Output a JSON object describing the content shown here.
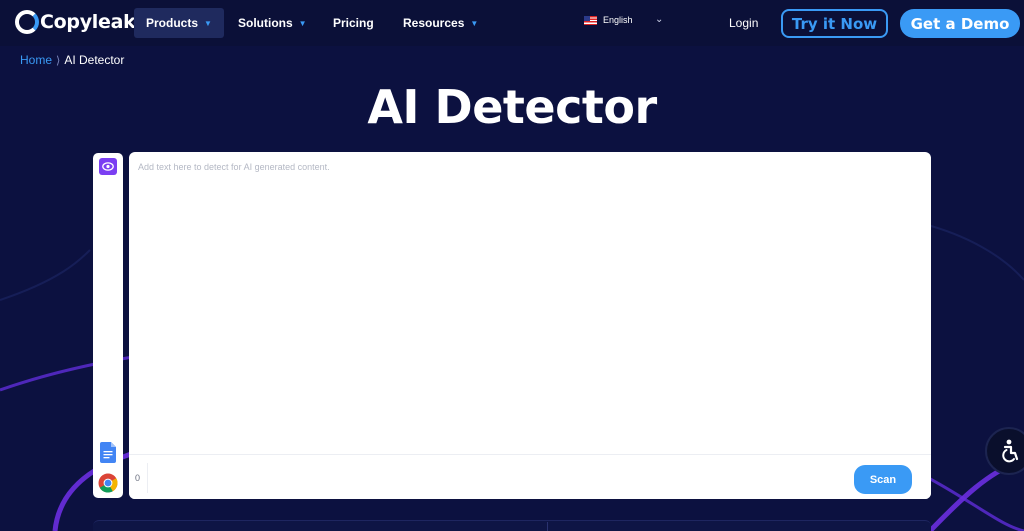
{
  "nav": {
    "logo_text": "Copyleaks",
    "items": [
      {
        "label": "Products",
        "has_caret": true,
        "active": true
      },
      {
        "label": "Solutions",
        "has_caret": true,
        "active": false
      },
      {
        "label": "Pricing",
        "has_caret": false,
        "active": false
      },
      {
        "label": "Resources",
        "has_caret": true,
        "active": false
      }
    ],
    "language": "English",
    "login": "Login",
    "try_now": "Try it Now",
    "get_demo": "Get a Demo"
  },
  "breadcrumb": {
    "home": "Home",
    "separator": "⟩",
    "current": "AI Detector"
  },
  "page_title": "AI Detector",
  "editor": {
    "placeholder": "Add text here to detect for AI generated content.",
    "value": "",
    "char_count": "0",
    "scan_label": "Scan"
  },
  "rail_icons": [
    "eye-icon",
    "google-docs-icon",
    "chrome-icon"
  ],
  "colors": {
    "background": "#0c1140",
    "accent": "#3a9af5",
    "purple": "#7b3ff2"
  }
}
